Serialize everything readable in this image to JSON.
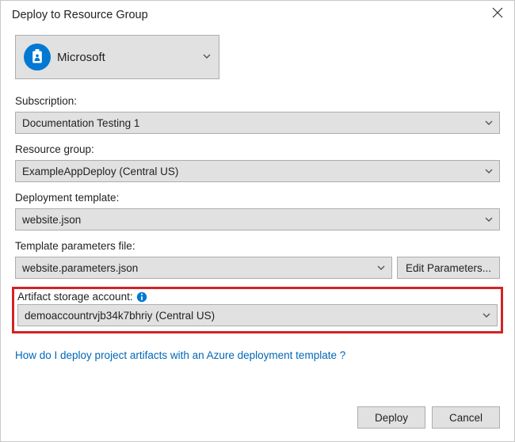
{
  "window": {
    "title": "Deploy to Resource Group"
  },
  "account": {
    "name": "Microsoft"
  },
  "subscription": {
    "label": "Subscription:",
    "value": "Documentation Testing 1"
  },
  "resource_group": {
    "label": "Resource group:",
    "value": "ExampleAppDeploy (Central US)"
  },
  "template": {
    "label": "Deployment template:",
    "value": "website.json"
  },
  "parameters_file": {
    "label": "Template parameters file:",
    "value": "website.parameters.json",
    "edit_label": "Edit Parameters..."
  },
  "artifact": {
    "label": "Artifact storage account:",
    "value": "demoaccountrvjb34k7bhriy (Central US)"
  },
  "help_link": "How do I deploy project artifacts with an Azure deployment template ?",
  "buttons": {
    "deploy": "Deploy",
    "cancel": "Cancel"
  }
}
